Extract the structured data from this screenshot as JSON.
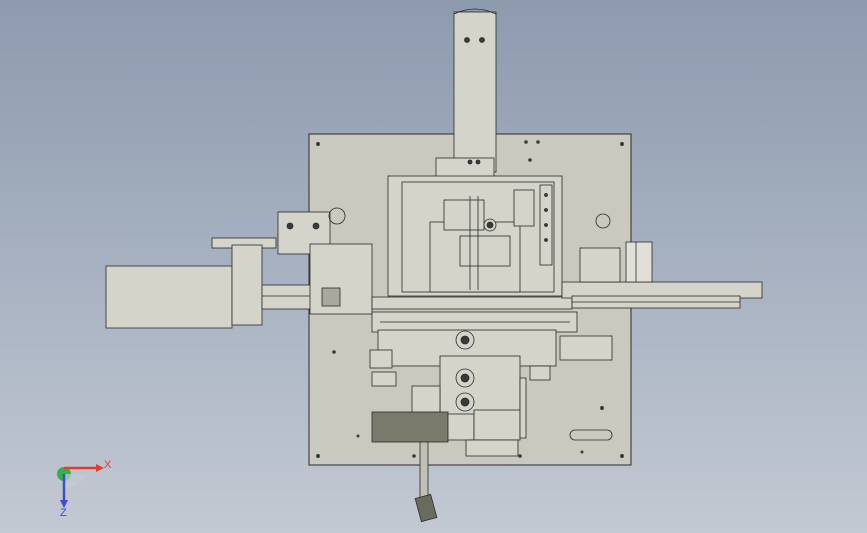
{
  "viewport": {
    "background_top": "#8e9aae",
    "background_bottom": "#c3c9d3"
  },
  "model": {
    "plate_color": "#c9c9bf",
    "part_color": "#d4d4cb",
    "part_dark": "#8a8a7e",
    "edge_color": "#2b2b2b",
    "hole_color": "#3a3a3a",
    "dark_block": "#7a7a6c"
  },
  "triad": {
    "x_label": "X",
    "z_label": "Z",
    "x_color": "#e33b2f",
    "y_color": "#35b14a",
    "z_color": "#3a4fc9"
  }
}
